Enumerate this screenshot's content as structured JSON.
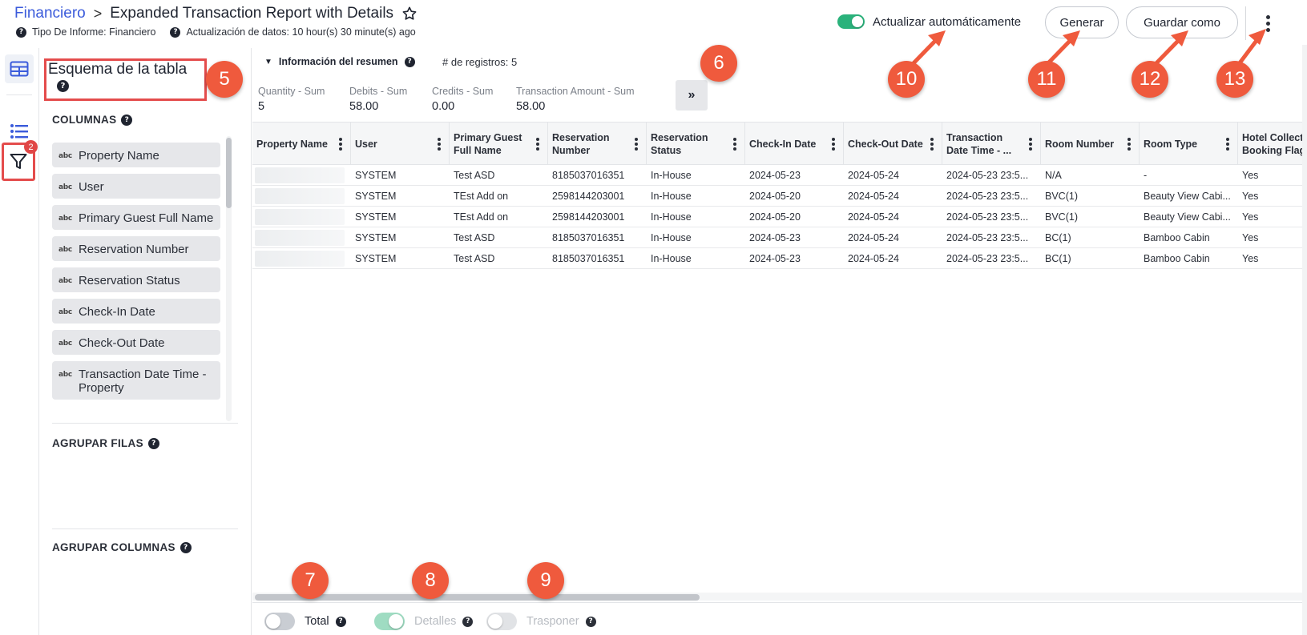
{
  "header": {
    "breadcrumb_root": "Financiero",
    "breadcrumb_sep": ">",
    "title": "Expanded Transaction Report with Details",
    "report_type": "Tipo De Informe: Financiero",
    "data_update": "Actualización de datos: 10 hour(s) 30 minute(s) ago",
    "auto_update_label": "Actualizar automáticamente",
    "auto_update_on": true,
    "generate_label": "Generar",
    "save_as_label": "Guardar como"
  },
  "rail": {
    "filter_badge": "2"
  },
  "schema": {
    "title": "Esquema de la tabla",
    "columns_label": "COLUMNAS",
    "columns": [
      "Property Name",
      "User",
      "Primary Guest Full Name",
      "Reservation Number",
      "Reservation Status",
      "Check-In Date",
      "Check-Out Date",
      "Transaction Date Time - Property"
    ],
    "type_tag": "abc",
    "group_rows_label": "AGRUPAR FILAS",
    "group_columns_label": "AGRUPAR COLUMNAS"
  },
  "summary": {
    "heading": "Información del resumen",
    "count": "# de registros: 5",
    "items": [
      {
        "label": "Quantity - Sum",
        "value": "5"
      },
      {
        "label": "Debits - Sum",
        "value": "58.00"
      },
      {
        "label": "Credits - Sum",
        "value": "0.00"
      },
      {
        "label": "Transaction Amount - Sum",
        "value": "58.00"
      }
    ],
    "expand_glyph": "»"
  },
  "table": {
    "headers": [
      "Property Name",
      "User",
      "Primary Guest Full Name",
      "Reservation Number",
      "Reservation Status",
      "Check-In Date",
      "Check-Out Date",
      "Transaction Date Time - ...",
      "Room Number",
      "Room Type",
      "Hotel Collect Booking Flag"
    ],
    "rows": [
      [
        "",
        "SYSTEM",
        "Test ASD",
        "8185037016351",
        "In-House",
        "2024-05-23",
        "2024-05-24",
        "2024-05-23 23:5...",
        "N/A",
        "-",
        "Yes"
      ],
      [
        "",
        "SYSTEM",
        "TEst Add on",
        "2598144203001",
        "In-House",
        "2024-05-20",
        "2024-05-24",
        "2024-05-23 23:5...",
        "BVC(1)",
        "Beauty View Cabi...",
        "Yes"
      ],
      [
        "",
        "SYSTEM",
        "TEst Add on",
        "2598144203001",
        "In-House",
        "2024-05-20",
        "2024-05-24",
        "2024-05-23 23:5...",
        "BVC(1)",
        "Beauty View Cabi...",
        "Yes"
      ],
      [
        "",
        "SYSTEM",
        "Test ASD",
        "8185037016351",
        "In-House",
        "2024-05-23",
        "2024-05-24",
        "2024-05-23 23:5...",
        "BC(1)",
        "Bamboo Cabin",
        "Yes"
      ],
      [
        "",
        "SYSTEM",
        "Test ASD",
        "8185037016351",
        "In-House",
        "2024-05-23",
        "2024-05-24",
        "2024-05-23 23:5...",
        "BC(1)",
        "Bamboo Cabin",
        "Yes"
      ]
    ]
  },
  "footer": {
    "total_label": "Total",
    "total_on": false,
    "details_label": "Detalles",
    "details_on": true,
    "transpose_label": "Trasponer",
    "transpose_on": false
  },
  "callouts": [
    "5",
    "6",
    "7",
    "8",
    "9",
    "10",
    "11",
    "12",
    "13"
  ],
  "colors": {
    "accent": "#3b5bdb",
    "toggle_on": "#2ab27b",
    "callout": "#ef5a3d",
    "highlight_box": "#e44c4c"
  },
  "icons": [
    "star-icon",
    "help-icon",
    "table-icon",
    "list-icon",
    "filter-icon",
    "kebab-icon",
    "chevron-down-icon",
    "column-menu-icon"
  ]
}
